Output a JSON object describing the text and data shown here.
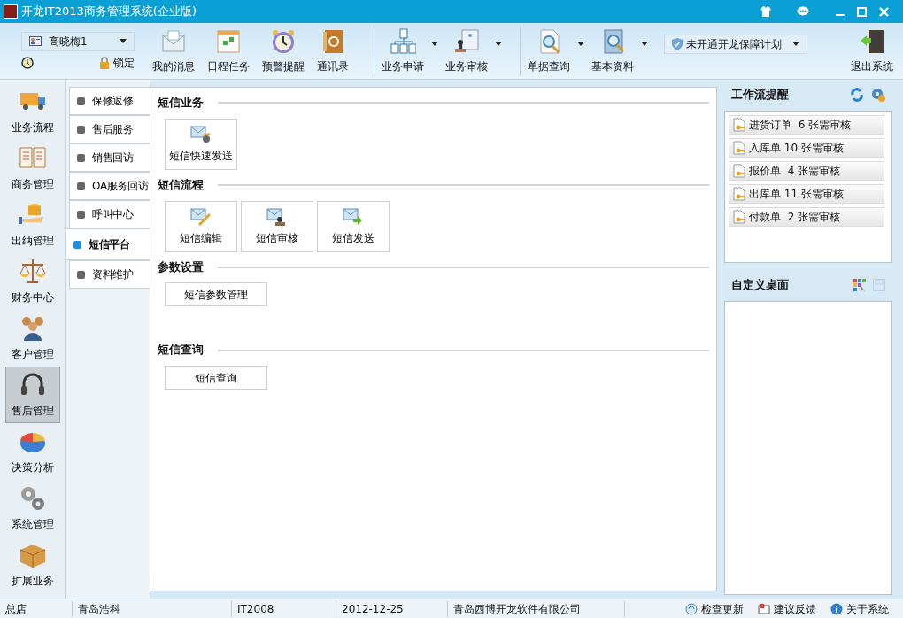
{
  "window": {
    "title": "开龙IT2013商务管理系统(企业版)"
  },
  "toolbar": {
    "user": "高晓梅1",
    "lock": "锁定",
    "buttons": [
      {
        "label": "我的消息",
        "dropdown": false,
        "group_start": false
      },
      {
        "label": "日程任务",
        "dropdown": false,
        "group_start": false
      },
      {
        "label": "预警提醒",
        "dropdown": false,
        "group_start": false
      },
      {
        "label": "通讯录",
        "dropdown": false,
        "group_start": false
      },
      {
        "label": "业务申请",
        "dropdown": true,
        "group_start": true
      },
      {
        "label": "业务审核",
        "dropdown": true,
        "group_start": false
      },
      {
        "label": "单据查询",
        "dropdown": true,
        "group_start": true
      },
      {
        "label": "基本资料",
        "dropdown": true,
        "group_start": false
      }
    ],
    "protection": "未开通开龙保障计划",
    "exit": "退出系统"
  },
  "sidebar": {
    "items": [
      {
        "label": "业务流程",
        "selected": false
      },
      {
        "label": "商务管理",
        "selected": false
      },
      {
        "label": "出纳管理",
        "selected": false
      },
      {
        "label": "财务中心",
        "selected": false
      },
      {
        "label": "客户管理",
        "selected": false
      },
      {
        "label": "售后管理",
        "selected": true
      },
      {
        "label": "决策分析",
        "selected": false
      },
      {
        "label": "系统管理",
        "selected": false
      },
      {
        "label": "扩展业务",
        "selected": false
      }
    ]
  },
  "subnav": {
    "items": [
      {
        "label": "保修返修",
        "selected": false
      },
      {
        "label": "售后服务",
        "selected": false
      },
      {
        "label": "销售回访",
        "selected": false
      },
      {
        "label": "OA服务回访",
        "selected": false
      },
      {
        "label": "呼叫中心",
        "selected": false
      },
      {
        "label": "短信平台",
        "selected": true
      },
      {
        "label": "资料维护",
        "selected": false
      }
    ]
  },
  "sections": [
    {
      "title": "短信业务",
      "buttons": [
        {
          "label": "短信快速发送",
          "kind": "tile"
        }
      ]
    },
    {
      "title": "短信流程",
      "buttons": [
        {
          "label": "短信编辑",
          "kind": "tile"
        },
        {
          "label": "短信审核",
          "kind": "tile"
        },
        {
          "label": "短信发送",
          "kind": "tile"
        }
      ]
    },
    {
      "title": "参数设置",
      "buttons": [
        {
          "label": "短信参数管理",
          "kind": "plain"
        }
      ]
    },
    {
      "title": "短信查询",
      "buttons": [
        {
          "label": "短信查询",
          "kind": "plain"
        }
      ]
    }
  ],
  "workflow": {
    "title": "工作流提醒",
    "items": [
      {
        "doc": "进货订单",
        "count": "6",
        "text": "张需审核"
      },
      {
        "doc": "入库单",
        "count": "10",
        "text": "张需审核"
      },
      {
        "doc": "报价单",
        "count": "4",
        "text": "张需审核"
      },
      {
        "doc": "出库单",
        "count": "11",
        "text": "张需审核"
      },
      {
        "doc": "付款单",
        "count": "2",
        "text": "张需审核"
      }
    ]
  },
  "desktop": {
    "title": "自定义桌面"
  },
  "status_bar": {
    "fields": [
      "总店",
      "青岛浩科",
      "IT2008",
      "2012-12-25",
      "青岛西博开龙软件有限公司"
    ],
    "links": [
      "检查更新",
      "建议反馈",
      "关于系统"
    ]
  }
}
